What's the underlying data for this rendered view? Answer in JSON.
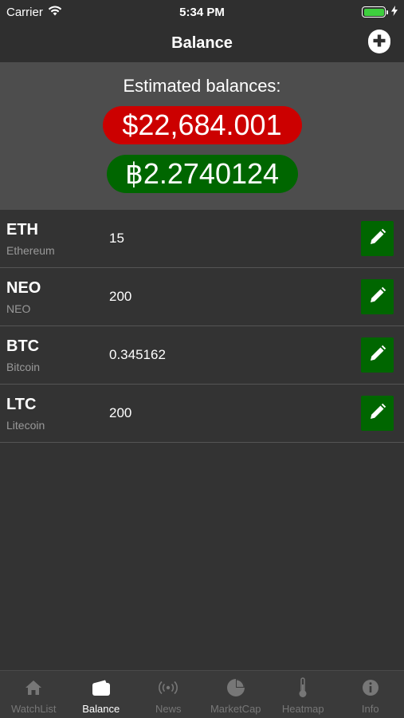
{
  "status_bar": {
    "carrier": "Carrier",
    "time": "5:34 PM",
    "battery_level": 1.0,
    "colors": {
      "battery": "#3ecf3e"
    }
  },
  "nav": {
    "title": "Balance",
    "add_icon": "plus-circle-icon"
  },
  "summary": {
    "label": "Estimated balances:",
    "usd_value": "$22,684.001",
    "btc_value": "฿2.2740124",
    "colors": {
      "usd_bg": "#cc0000",
      "btc_bg": "#006600"
    }
  },
  "holdings": [
    {
      "symbol": "ETH",
      "name": "Ethereum",
      "amount": "15",
      "edit_icon": "pencil-icon"
    },
    {
      "symbol": "NEO",
      "name": "NEO",
      "amount": "200",
      "edit_icon": "pencil-icon"
    },
    {
      "symbol": "BTC",
      "name": "Bitcoin",
      "amount": "0.345162",
      "edit_icon": "pencil-icon"
    },
    {
      "symbol": "LTC",
      "name": "Litecoin",
      "amount": "200",
      "edit_icon": "pencil-icon"
    }
  ],
  "tabs": [
    {
      "label": "WatchList",
      "icon": "home-icon",
      "active": false
    },
    {
      "label": "Balance",
      "icon": "wallet-icon",
      "active": true
    },
    {
      "label": "News",
      "icon": "broadcast-icon",
      "active": false
    },
    {
      "label": "MarketCap",
      "icon": "pie-chart-icon",
      "active": false
    },
    {
      "label": "Heatmap",
      "icon": "thermometer-icon",
      "active": false
    },
    {
      "label": "Info",
      "icon": "info-icon",
      "active": false
    }
  ],
  "colors": {
    "background": "#333333",
    "panel": "#4d4d4d",
    "edit_button": "#006600",
    "inactive_tab": "#777777"
  }
}
